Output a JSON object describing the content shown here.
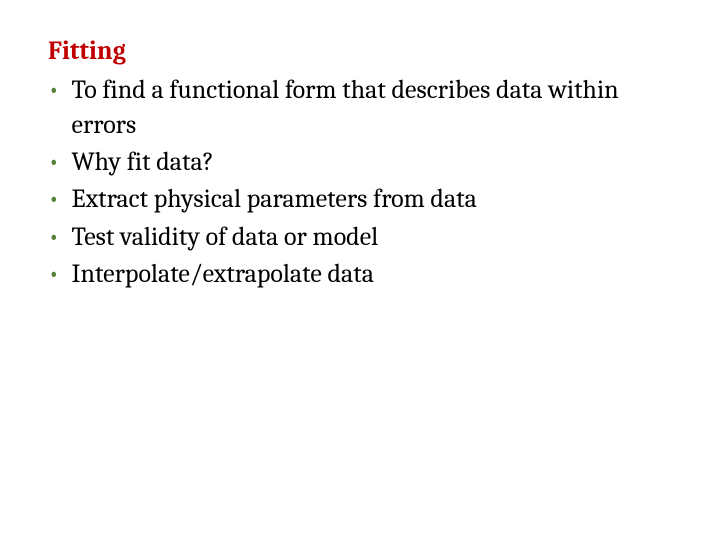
{
  "slide": {
    "title": "Fitting",
    "bullets": [
      "To find a functional form that describes data within errors",
      " Why fit data?",
      "Extract physical parameters from data",
      "Test validity of data or model",
      "Interpolate/extrapolate data"
    ]
  }
}
